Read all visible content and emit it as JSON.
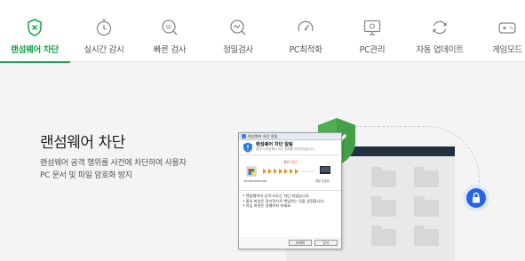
{
  "nav": {
    "items": [
      {
        "label": "랜섬웨어 차단",
        "icon": "shield-x-icon",
        "active": true
      },
      {
        "label": "실시간 감시",
        "icon": "stopwatch-icon",
        "active": false
      },
      {
        "label": "빠른 검사",
        "icon": "quick-scan-icon",
        "active": false
      },
      {
        "label": "정밀검사",
        "icon": "deep-scan-icon",
        "active": false
      },
      {
        "label": "PC최적화",
        "icon": "gauge-icon",
        "active": false
      },
      {
        "label": "PC관리",
        "icon": "monitor-gear-icon",
        "active": false
      },
      {
        "label": "자동 업데이트",
        "icon": "refresh-icon",
        "active": false
      },
      {
        "label": "게임모드",
        "icon": "gamepad-icon",
        "active": false
      }
    ],
    "accent_color": "#16a34a"
  },
  "feature": {
    "title": "랜섬웨어 차단",
    "description_line1": "랜섬웨어 공격 행위를 사전에 차단하여 사용자",
    "description_line2": "PC 문서 및 파일 암호화 방지"
  },
  "illustration": {
    "dialog": {
      "window_title": "랜섬웨어 차단 알림",
      "heading": "랜섬웨어 차단 알림",
      "subheading": "알약이 랜섬웨어 의심 행위를 차단하였습니다.",
      "flow_label": "행위 차단",
      "source_name": "ransomware.exe",
      "target_name": "파일 암호화",
      "notes": [
        "• 랜섬웨어의 공격 시도는 차단 되었습니다.",
        "• 중요 파일은 정기적으로 백업하는 것을 권장합니다.",
        "• 의심 파일은 실행하지 마세요."
      ],
      "button_primary": "자세히",
      "button_secondary": "닫기"
    },
    "shield_color": "#4caf50",
    "lock_color": "#2563eb"
  }
}
